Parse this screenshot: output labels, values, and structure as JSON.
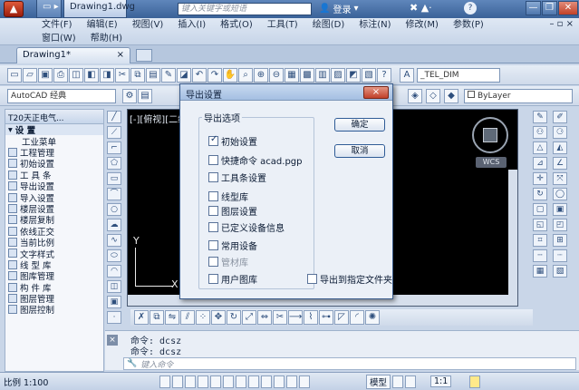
{
  "window": {
    "tabs": [
      "Drawing1.dwg"
    ],
    "search_placeholder": "键入关键字或短语",
    "login_label": "登录",
    "help_label": "?"
  },
  "menu": {
    "row1": [
      "文件(F)",
      "编辑(E)",
      "视图(V)",
      "插入(I)",
      "格式(O)",
      "工具(T)",
      "绘图(D)",
      "标注(N)",
      "修改(M)",
      "参数(P)"
    ],
    "row2": [
      "窗口(W)",
      "帮助(H)"
    ]
  },
  "doc_tab": {
    "label": "Drawing1*",
    "close": "×"
  },
  "toolbar": {
    "style_text": "_TEL_DIM",
    "workspace": "AutoCAD 经典",
    "bylayer": "ByLayer"
  },
  "sidebar": {
    "header": "T20天正电气...",
    "section": "设 置",
    "items": [
      "工业菜单",
      "工程管理",
      "初始设置",
      "工 具 条",
      "导出设置",
      "导入设置",
      "楼层设置",
      "楼层复制",
      "依线正交",
      "当前比例",
      "文字样式",
      "线 型 库",
      "图库管理",
      "构 件 库",
      "图层管理",
      "图层控制"
    ]
  },
  "canvas": {
    "viewport_label": "[-][俯视][二维",
    "wcs": "WCS",
    "y_axis": "Y",
    "x_axis": "X"
  },
  "command": {
    "lines": [
      "命令: dcsz",
      "命令: dcsz"
    ],
    "prompt": "键入命令"
  },
  "status": {
    "scale": "比例 1:100",
    "model": "模型",
    "zoom": "1:1"
  },
  "dialog": {
    "title": "导出设置",
    "close": "×",
    "group_title": "导出选项",
    "options": [
      {
        "label": "初始设置",
        "checked": true
      },
      {
        "label": "快捷命令 acad.pgp",
        "checked": false
      },
      {
        "label": "工具条设置",
        "checked": false
      },
      {
        "label": "线型库",
        "checked": false
      },
      {
        "label": "图层设置",
        "checked": false
      },
      {
        "label": "已定义设备信息",
        "checked": false
      },
      {
        "label": "常用设备",
        "checked": false
      },
      {
        "label": "管材库",
        "checked": false
      },
      {
        "label": "用户图库",
        "checked": false
      }
    ],
    "ok": "确定",
    "cancel": "取消",
    "export_folder": "导出到指定文件夹"
  }
}
